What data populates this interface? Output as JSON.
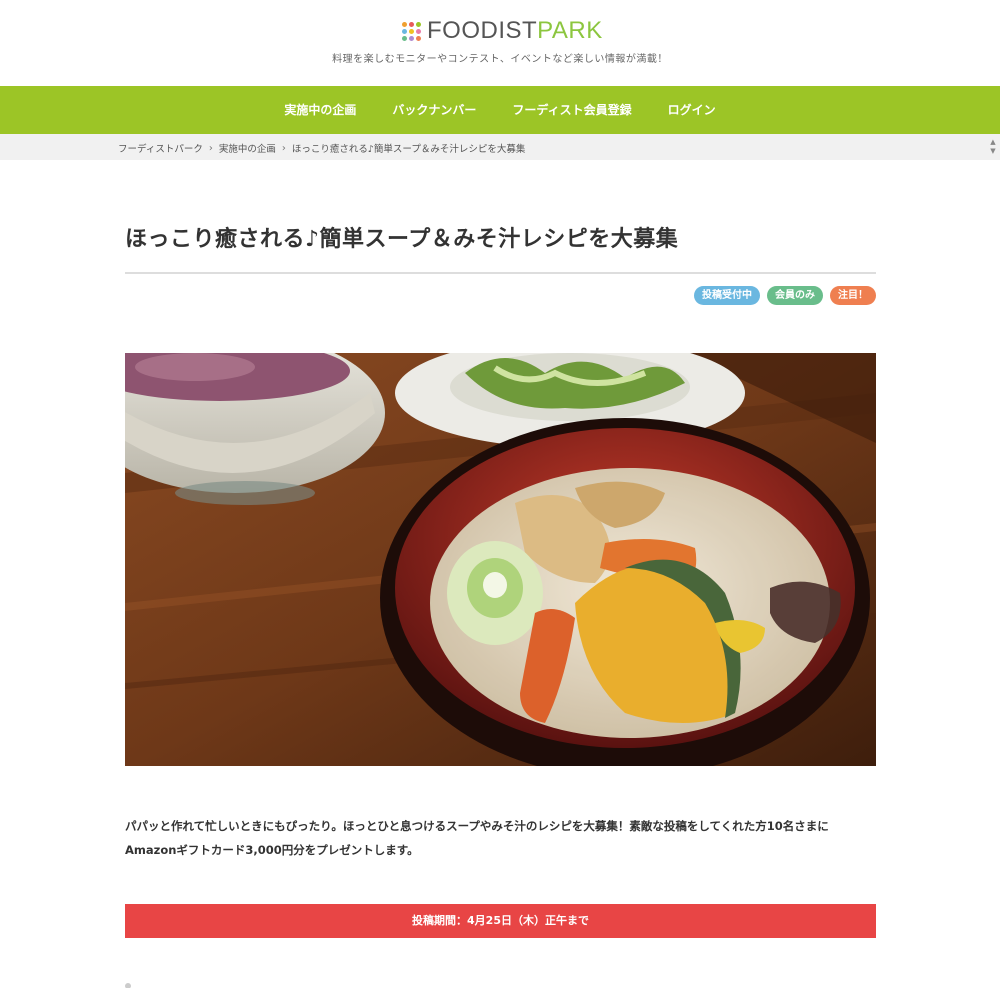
{
  "header": {
    "logo_part1": "FOODIST",
    "logo_part2": "PARK",
    "tagline": "料理を楽しむモニターやコンテスト、イベントなど楽しい情報が満載！",
    "logo_dot_colors": [
      "#f0a030",
      "#e85a5a",
      "#9cc526",
      "#6ab7e0",
      "#f0c020",
      "#e87aa8",
      "#69bd8b",
      "#b08ad0",
      "#ef7f50"
    ]
  },
  "nav": {
    "items": [
      {
        "label": "実施中の企画"
      },
      {
        "label": "バックナンバー"
      },
      {
        "label": "フーディスト会員登録"
      },
      {
        "label": "ログイン"
      }
    ],
    "bg_color": "#9cc526"
  },
  "breadcrumb": {
    "items": [
      "フーディストパーク",
      "実施中の企画",
      "ほっこり癒される♪簡単スープ＆みそ汁レシピを大募集"
    ],
    "separator": "›",
    "scroll_up": "▲",
    "scroll_down": "▼"
  },
  "article": {
    "title": "ほっこり癒される♪簡単スープ＆みそ汁レシピを大募集",
    "tags": [
      {
        "label": "投稿受付中",
        "color": "#6ab7e0"
      },
      {
        "label": "会員のみ",
        "color": "#69bd8b"
      },
      {
        "label": "注目！",
        "color": "#ef7f50"
      }
    ],
    "description_line1": "パパッと作れて忙しいときにもぴったり。ほっとひと息つけるスープやみそ汁のレシピを大募集！素敵な投稿をしてくれた方10名さまに",
    "description_line2": "Amazonギフトカード3,000円分をプレゼントします。",
    "deadline": "投稿期間：4月25日（木）正午まで",
    "deadline_color": "#e84545"
  }
}
